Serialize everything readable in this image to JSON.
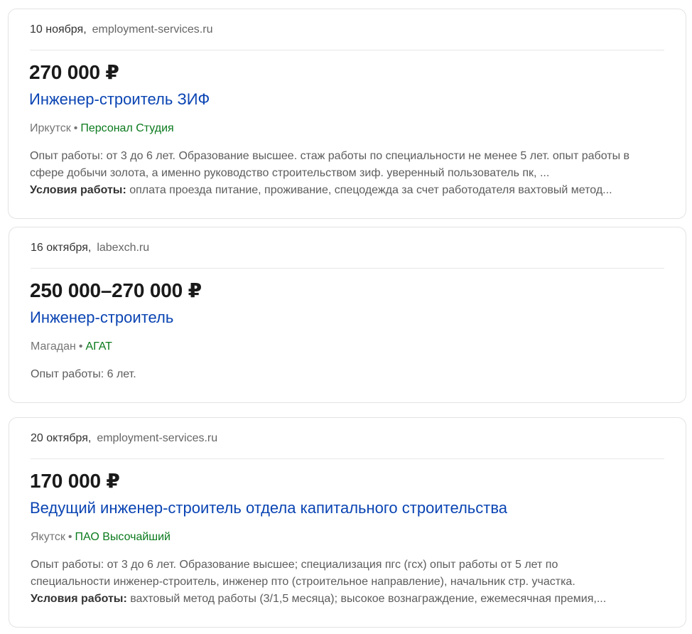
{
  "vacancies": [
    {
      "date": "10 ноября,",
      "source": "employment-services.ru",
      "salary": "270 000 ₽",
      "title": "Инженер-строитель ЗИФ",
      "city": "Иркутск",
      "separator": "•",
      "company": "Персонал Студия",
      "description_lines": [
        "Опыт работы: от 3 до 6 лет. Образование высшее. стаж работы по специальности не менее 5 лет. опыт работы в",
        "сфере добычи золота, а именно руководство строительством зиф. уверенный пользователь пк, ..."
      ],
      "conditions_label": "Условия работы:",
      "conditions_text": " оплата проезда питание, проживание, спецодежда за счет работодателя вахтовый метод..."
    },
    {
      "date": "16 октября,",
      "source": "labexch.ru",
      "salary": "250 000–270 000 ₽",
      "title": "Инженер-строитель",
      "city": "Магадан",
      "separator": "•",
      "company": "АГАТ",
      "description_lines": [
        "Опыт работы: 6 лет."
      ]
    },
    {
      "date": "20 октября,",
      "source": "employment-services.ru",
      "salary": "170 000 ₽",
      "title": "Ведущий инженер-строитель отдела капитального строительства",
      "city": "Якутск",
      "separator": "•",
      "company": "ПАО Высочайший",
      "description_lines": [
        "Опыт работы: от 3 до 6 лет. Образование высшее; специализация пгс (гсх) опыт работы от 5 лет по",
        "специальности инженер-строитель, инженер пто (строительное направление), начальник стр. участка."
      ],
      "conditions_label": "Условия работы:",
      "conditions_text": " вахтовый метод работы (3/1,5 месяца); высокое вознаграждение, ежемесячная премия,..."
    }
  ]
}
